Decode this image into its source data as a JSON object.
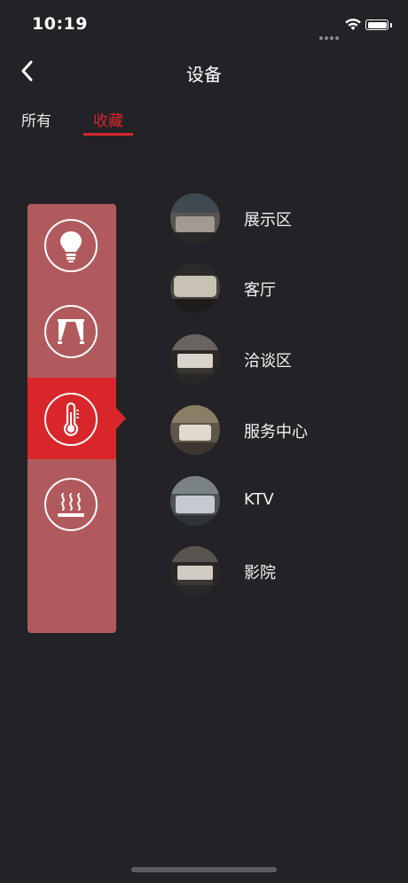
{
  "status_bar": {
    "time": "10:19",
    "icons": [
      "cellular-signal-icon",
      "wifi-icon",
      "battery-icon"
    ]
  },
  "nav": {
    "back_icon": "chevron-left-icon",
    "title": "设备"
  },
  "tabs": [
    {
      "label": "所有",
      "active": false
    },
    {
      "label": "收藏",
      "active": true
    }
  ],
  "categories": [
    {
      "icon": "light-bulb-icon",
      "active": false
    },
    {
      "icon": "curtain-icon",
      "active": true,
      "note": ""
    },
    {
      "icon": "thermometer-icon",
      "active": true
    },
    {
      "icon": "floor-heating-icon",
      "active": false
    }
  ],
  "rooms": [
    {
      "name": "展示区",
      "thumb_icon": "room-photo"
    },
    {
      "name": "客厅",
      "thumb_icon": "room-photo"
    },
    {
      "name": "洽谈区",
      "thumb_icon": "room-photo"
    },
    {
      "name": "服务中心",
      "thumb_icon": "room-photo"
    },
    {
      "name": "KTV",
      "thumb_icon": "room-photo"
    },
    {
      "name": "影院",
      "thumb_icon": "room-photo"
    }
  ],
  "colors": {
    "background": "#232226",
    "accent": "#d8262b",
    "category_panel": "#b15a5d",
    "text": "#ffffff"
  }
}
